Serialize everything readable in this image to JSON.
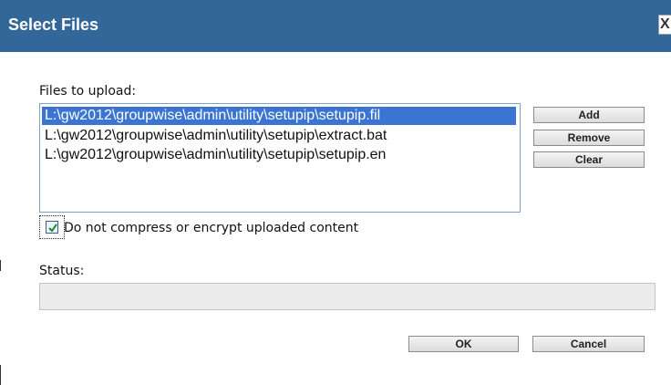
{
  "window": {
    "title": "Select Files",
    "close_glyph": "X"
  },
  "files": {
    "label": "Files to upload:",
    "items": [
      "L:\\gw2012\\groupwise\\admin\\utility\\setupip\\setupip.fil",
      "L:\\gw2012\\groupwise\\admin\\utility\\setupip\\extract.bat",
      "L:\\gw2012\\groupwise\\admin\\utility\\setupip\\setupip.en"
    ],
    "selected_index": 0
  },
  "buttons": {
    "add": "Add",
    "remove": "Remove",
    "clear": "Clear",
    "ok": "OK",
    "cancel": "Cancel"
  },
  "options": {
    "no_compress_label": "Do not compress or encrypt uploaded content",
    "no_compress_checked": true
  },
  "status": {
    "label": "Status:",
    "value": ""
  },
  "colors": {
    "titlebar": "#336699",
    "selection": "#3b75d1"
  },
  "icons": {
    "close": "close-icon",
    "check": "check-icon"
  }
}
